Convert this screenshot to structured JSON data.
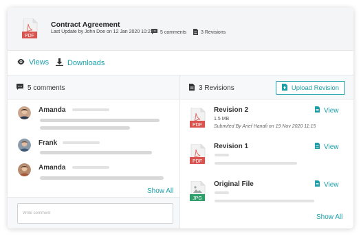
{
  "document": {
    "file_type": "PDF",
    "title": "Contract Agreement",
    "meta": "Last Update by John Doe  on 12 Jan 2020 10:23",
    "comments_count": "5 comments",
    "revisions_count": "3 Revisions"
  },
  "nav": {
    "views_label": "Views",
    "downloads_label": "Downloads"
  },
  "comments_panel": {
    "title": "5 comments",
    "items": [
      {
        "name": "Amanda"
      },
      {
        "name": "Frank"
      },
      {
        "name": "Amanda"
      }
    ],
    "show_all": "Show All",
    "input_placeholder": "Write comment"
  },
  "revisions_panel": {
    "title": "3 Revisions",
    "upload_label": "Upload Revision",
    "items": [
      {
        "file_type": "PDF",
        "title": "Revision 2",
        "size": "1.5 MB",
        "submitted": "Submited By Arief Hanafi on 19 Nov 2020 11:15",
        "view_label": "View"
      },
      {
        "file_type": "PDF",
        "title": "Revision 1",
        "view_label": "View"
      },
      {
        "file_type": "JPG",
        "title": "Original File",
        "view_label": "View"
      }
    ],
    "show_all": "Show All"
  },
  "colors": {
    "accent": "#1a9ea7",
    "pdf_red": "#d9534f",
    "jpg_green": "#2e9e6a"
  }
}
